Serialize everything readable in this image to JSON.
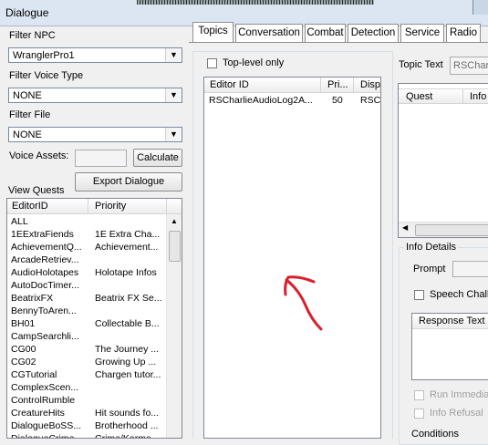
{
  "window": {
    "title": "Dialogue"
  },
  "left": {
    "filter_npc_label": "Filter NPC",
    "filter_npc_value": "WranglerPro1",
    "filter_voice_label": "Filter Voice Type",
    "filter_voice_value": "NONE",
    "filter_file_label": "Filter File",
    "filter_file_value": "NONE",
    "voice_assets_label": "Voice Assets:",
    "calculate_label": "Calculate",
    "export_label": "Export Dialogue",
    "view_quests_label": "View Quests",
    "quest_columns": [
      "EditorID",
      "Priority"
    ],
    "quests": [
      {
        "id": "ALL",
        "name": ""
      },
      {
        "id": "1EExtraFiends",
        "name": "1E Extra Cha..."
      },
      {
        "id": "AchievementQ...",
        "name": "Achievement..."
      },
      {
        "id": "ArcadeRetriev...",
        "name": ""
      },
      {
        "id": "AudioHolotapes",
        "name": "Holotape Infos"
      },
      {
        "id": "AutoDocTimer...",
        "name": ""
      },
      {
        "id": "BeatrixFX",
        "name": "Beatrix FX Se..."
      },
      {
        "id": "BennyToAren...",
        "name": ""
      },
      {
        "id": "BH01",
        "name": "Collectable B..."
      },
      {
        "id": "CampSearchli...",
        "name": ""
      },
      {
        "id": "CG00",
        "name": "The Journey ..."
      },
      {
        "id": "CG02",
        "name": "Growing Up ..."
      },
      {
        "id": "CGTutorial",
        "name": "Chargen tutor..."
      },
      {
        "id": "ComplexScen...",
        "name": ""
      },
      {
        "id": "ControlRumble",
        "name": ""
      },
      {
        "id": "CreatureHits",
        "name": "Hit sounds fo..."
      },
      {
        "id": "DialogueBoSS...",
        "name": "Brotherhood ..."
      },
      {
        "id": "DialogueCrime...",
        "name": "Crime/Karma..."
      }
    ]
  },
  "tabs": [
    "Topics",
    "Conversation",
    "Combat",
    "Detection",
    "Service",
    "Radio"
  ],
  "topics": {
    "toplevel_label": "Top-level only",
    "columns": [
      "Editor ID",
      "Pri...",
      "Disp"
    ],
    "rows": [
      {
        "id": "RSCharlieAudioLog2A...",
        "priority": "50",
        "disp": "RSC"
      }
    ]
  },
  "right": {
    "topic_text_label": "Topic Text",
    "topic_text_value": "RSCharl",
    "quest_info_columns": [
      "Quest",
      "Info"
    ],
    "info_details_label": "Info Details",
    "prompt_label": "Prompt",
    "speech_label": "Speech Chall",
    "response_text_label": "Response Text",
    "run_immediate_label": "Run Immediat",
    "info_refusal_label": "Info Refusal",
    "conditions_label": "Conditions"
  },
  "annotation": {
    "color": "#d8202c"
  }
}
